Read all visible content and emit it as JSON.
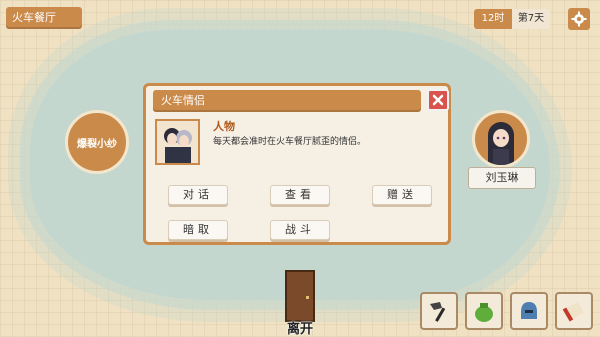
{
  "location": {
    "name": "火车餐厅"
  },
  "clock": {
    "hour": "12时",
    "day": "第7天"
  },
  "icons": {
    "settings": "gear-icon",
    "close": "close-icon",
    "door": "door-icon",
    "items": [
      "axe-icon",
      "green-bag-icon",
      "helmet-icon",
      "scroll-icon"
    ]
  },
  "characters": {
    "left": {
      "name": "爆裂小纱"
    },
    "right": {
      "name": "刘玉琳"
    }
  },
  "exit": {
    "label": "离开"
  },
  "dialog": {
    "title": "火车情侣",
    "type": "人物",
    "description": "每天都会准时在火车餐厅腻歪的情侣。",
    "actions": [
      "对话",
      "查看",
      "赠送",
      "暗取",
      "战斗"
    ]
  },
  "colors": {
    "accent": "#c98a4a",
    "danger": "#d9534f",
    "floor": "#c4d7cf"
  }
}
